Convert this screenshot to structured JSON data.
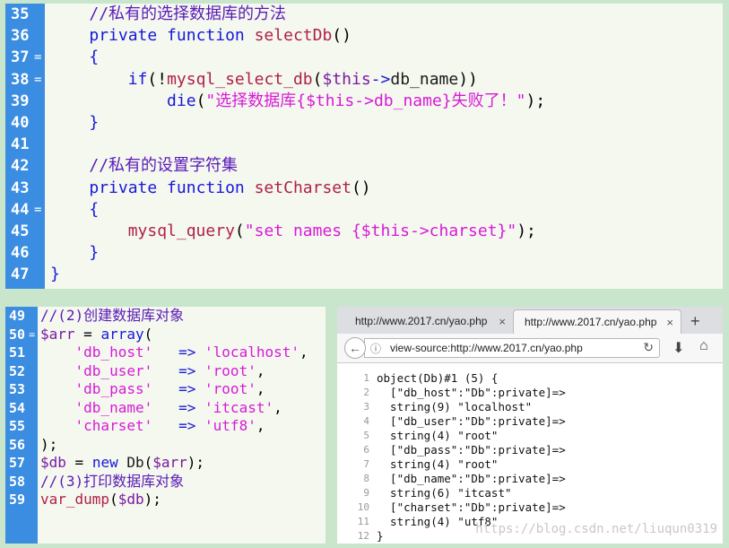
{
  "top_editor": {
    "lines": [
      {
        "num": "35",
        "fold": "",
        "indent": "    ",
        "tokens": [
          [
            "c-comment",
            "//私有的选择数据库的方法"
          ]
        ]
      },
      {
        "num": "36",
        "fold": "",
        "indent": "    ",
        "tokens": [
          [
            "c-kw",
            "private function "
          ],
          [
            "c-fn",
            "selectDb"
          ],
          [
            "c-plain",
            "()"
          ]
        ]
      },
      {
        "num": "37",
        "fold": "=",
        "indent": "    ",
        "tokens": [
          [
            "c-brace",
            "{"
          ]
        ]
      },
      {
        "num": "38",
        "fold": "=",
        "indent": "        ",
        "tokens": [
          [
            "c-kw",
            "if"
          ],
          [
            "c-plain",
            "(!"
          ],
          [
            "c-fn",
            "mysql_select_db"
          ],
          [
            "c-plain",
            "("
          ],
          [
            "c-var",
            "$this"
          ],
          [
            "c-op",
            "->"
          ],
          [
            "c-dark",
            "db_name"
          ],
          [
            "c-plain",
            "))"
          ]
        ]
      },
      {
        "num": "39",
        "fold": "",
        "indent": "            ",
        "tokens": [
          [
            "c-kw",
            "die"
          ],
          [
            "c-plain",
            "("
          ],
          [
            "c-str",
            "\"选择数据库{$this->db_name}失败了！\""
          ],
          [
            "c-plain",
            ");"
          ]
        ]
      },
      {
        "num": "40",
        "fold": "",
        "indent": "    ",
        "tokens": [
          [
            "c-brace",
            "}"
          ]
        ]
      },
      {
        "num": "41",
        "fold": "",
        "indent": "",
        "tokens": []
      },
      {
        "num": "42",
        "fold": "",
        "indent": "    ",
        "tokens": [
          [
            "c-comment",
            "//私有的设置字符集"
          ]
        ]
      },
      {
        "num": "43",
        "fold": "",
        "indent": "    ",
        "tokens": [
          [
            "c-kw",
            "private function "
          ],
          [
            "c-fn",
            "setCharset"
          ],
          [
            "c-plain",
            "()"
          ]
        ]
      },
      {
        "num": "44",
        "fold": "=",
        "indent": "    ",
        "tokens": [
          [
            "c-brace",
            "{"
          ]
        ]
      },
      {
        "num": "45",
        "fold": "",
        "indent": "        ",
        "tokens": [
          [
            "c-fn",
            "mysql_query"
          ],
          [
            "c-plain",
            "("
          ],
          [
            "c-str",
            "\"set names {$this->charset}\""
          ],
          [
            "c-plain",
            ");"
          ]
        ]
      },
      {
        "num": "46",
        "fold": "",
        "indent": "    ",
        "tokens": [
          [
            "c-brace",
            "}"
          ]
        ]
      },
      {
        "num": "47",
        "fold": "",
        "indent": "",
        "tokens": [
          [
            "c-brace",
            "}"
          ]
        ]
      }
    ]
  },
  "bottom_editor": {
    "lines": [
      {
        "num": "49",
        "fold": "",
        "indent": "",
        "tokens": [
          [
            "c-comment",
            "//(2)创建数据库对象"
          ]
        ]
      },
      {
        "num": "50",
        "fold": "=",
        "indent": "",
        "tokens": [
          [
            "c-var",
            "$arr"
          ],
          [
            "c-plain",
            " = "
          ],
          [
            "c-kw",
            "array"
          ],
          [
            "c-plain",
            "("
          ]
        ]
      },
      {
        "num": "51",
        "fold": "",
        "indent": "    ",
        "tokens": [
          [
            "c-str",
            "'db_host'"
          ],
          [
            "c-op",
            "   => "
          ],
          [
            "c-str",
            "'localhost'"
          ],
          [
            "c-plain",
            ","
          ]
        ]
      },
      {
        "num": "52",
        "fold": "",
        "indent": "    ",
        "tokens": [
          [
            "c-str",
            "'db_user'"
          ],
          [
            "c-op",
            "   => "
          ],
          [
            "c-str",
            "'root'"
          ],
          [
            "c-plain",
            ","
          ]
        ]
      },
      {
        "num": "53",
        "fold": "",
        "indent": "    ",
        "tokens": [
          [
            "c-str",
            "'db_pass'"
          ],
          [
            "c-op",
            "   => "
          ],
          [
            "c-str",
            "'root'"
          ],
          [
            "c-plain",
            ","
          ]
        ]
      },
      {
        "num": "54",
        "fold": "",
        "indent": "    ",
        "tokens": [
          [
            "c-str",
            "'db_name'"
          ],
          [
            "c-op",
            "   => "
          ],
          [
            "c-str",
            "'itcast'"
          ],
          [
            "c-plain",
            ","
          ]
        ]
      },
      {
        "num": "55",
        "fold": "",
        "indent": "    ",
        "tokens": [
          [
            "c-str",
            "'charset'"
          ],
          [
            "c-op",
            "   => "
          ],
          [
            "c-str",
            "'utf8'"
          ],
          [
            "c-plain",
            ","
          ]
        ]
      },
      {
        "num": "56",
        "fold": "",
        "indent": "",
        "tokens": [
          [
            "c-plain",
            ");"
          ]
        ]
      },
      {
        "num": "57",
        "fold": "",
        "indent": "",
        "tokens": [
          [
            "c-var",
            "$db"
          ],
          [
            "c-plain",
            " = "
          ],
          [
            "c-kw",
            "new "
          ],
          [
            "c-dark",
            "Db"
          ],
          [
            "c-plain",
            "("
          ],
          [
            "c-var",
            "$arr"
          ],
          [
            "c-plain",
            ");"
          ]
        ]
      },
      {
        "num": "58",
        "fold": "",
        "indent": "",
        "tokens": [
          [
            "c-comment",
            "//(3)打印数据库对象"
          ]
        ]
      },
      {
        "num": "59",
        "fold": "",
        "indent": "",
        "tokens": [
          [
            "c-fn",
            "var_dump"
          ],
          [
            "c-plain",
            "("
          ],
          [
            "c-var",
            "$db"
          ],
          [
            "c-plain",
            ");"
          ]
        ]
      }
    ]
  },
  "browser": {
    "tabs": [
      {
        "label": "http://www.2017.cn/yao.php",
        "close": "×"
      },
      {
        "label": "http://www.2017.cn/yao.php",
        "close": "×"
      }
    ],
    "new_tab": "+",
    "url": "view-source:http://www.2017.cn/yao.php",
    "icons": {
      "back": "back-arrow-icon",
      "info": "info-icon",
      "reload": "reload-icon",
      "download": "download-icon",
      "home": "home-icon"
    },
    "source_lines": [
      {
        "num": "1",
        "text": "object(Db)#1 (5) {"
      },
      {
        "num": "2",
        "text": "  [\"db_host\":\"Db\":private]=>"
      },
      {
        "num": "3",
        "text": "  string(9) \"localhost\""
      },
      {
        "num": "4",
        "text": "  [\"db_user\":\"Db\":private]=>"
      },
      {
        "num": "5",
        "text": "  string(4) \"root\""
      },
      {
        "num": "6",
        "text": "  [\"db_pass\":\"Db\":private]=>"
      },
      {
        "num": "7",
        "text": "  string(4) \"root\""
      },
      {
        "num": "8",
        "text": "  [\"db_name\":\"Db\":private]=>"
      },
      {
        "num": "9",
        "text": "  string(6) \"itcast\""
      },
      {
        "num": "10",
        "text": "  [\"charset\":\"Db\":private]=>"
      },
      {
        "num": "11",
        "text": "  string(4) \"utf8\""
      },
      {
        "num": "12",
        "text": "}"
      }
    ],
    "watermark": "https://blog.csdn.net/liuqun0319"
  }
}
